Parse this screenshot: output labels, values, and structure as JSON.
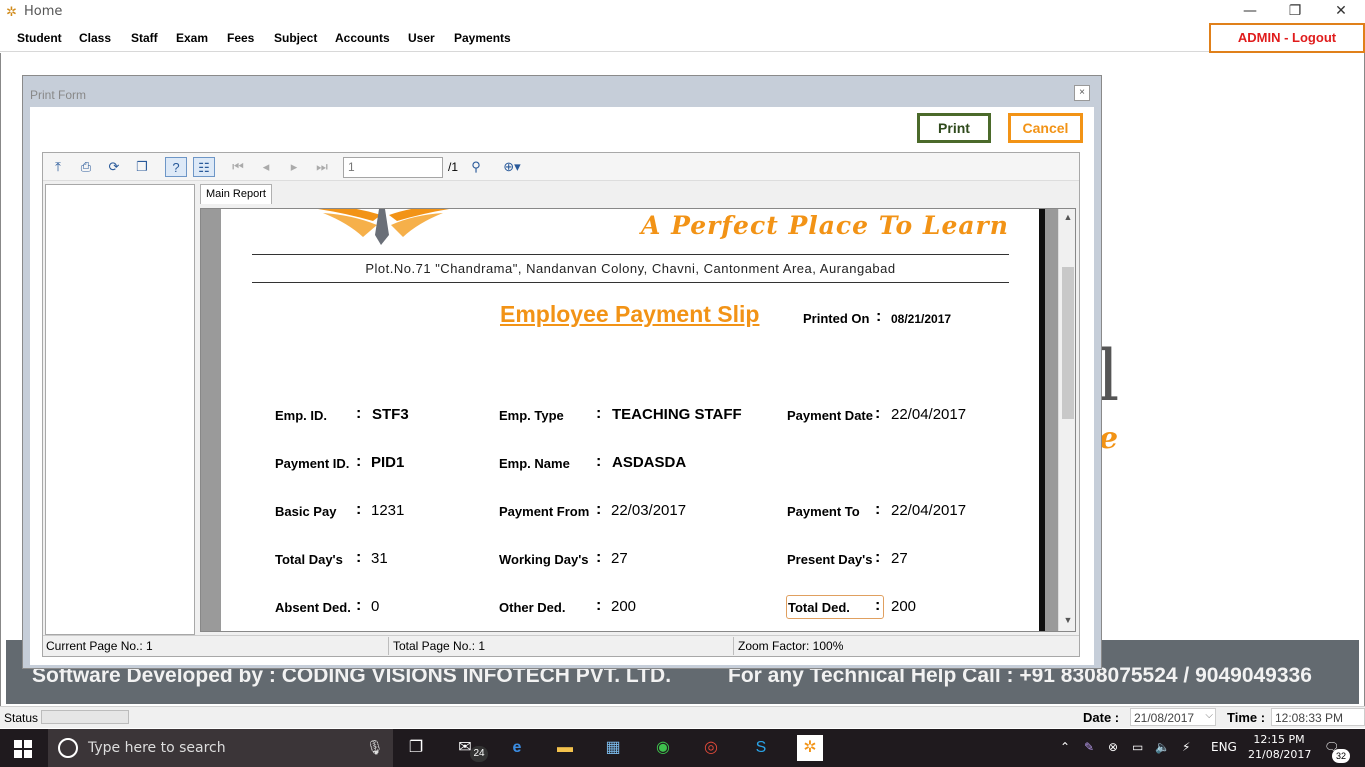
{
  "window": {
    "title": "Home",
    "minimize": "—",
    "restore": "❐",
    "close": "✕"
  },
  "menu": [
    "Student",
    "Class",
    "Staff",
    "Exam",
    "Fees",
    "Subject",
    "Accounts",
    "User",
    "Payments"
  ],
  "logout_label": "ADMIN - Logout",
  "background": {
    "footer_developer": "Software Developed by : CODING VISIONS INFOTECH PVT. LTD.",
    "footer_help": "For any Technical Help Call : +91 8308075524 / 9049049336",
    "letter": "l",
    "letter2": "e"
  },
  "dialog": {
    "title": "Print Form",
    "close": "×",
    "print_label": "Print",
    "cancel_label": "Cancel"
  },
  "viewer": {
    "page_input": "1",
    "page_total": "/1",
    "tab_label": "Main Report",
    "current_page": "Current Page No.: 1",
    "total_page": "Total Page No.: 1",
    "zoom": "Zoom Factor: 100%"
  },
  "report": {
    "tagline": "A Perfect Place To Learn",
    "address": "Plot.No.71 \"Chandrama\", Nandanvan Colony, Chavni, Cantonment Area, Aurangabad",
    "title": "Employee Payment Slip",
    "printed_on_label": "Printed On",
    "printed_on": "08/21/2017",
    "colon": ":",
    "fields": {
      "emp_id_label": "Emp. ID.",
      "emp_id": "STF3",
      "emp_type_label": "Emp. Type",
      "emp_type": "TEACHING STAFF",
      "payment_date_label": "Payment Date",
      "payment_date": "22/04/2017",
      "payment_id_label": "Payment ID.",
      "payment_id": "PID1",
      "emp_name_label": "Emp. Name",
      "emp_name": "ASDASDA",
      "basic_pay_label": "Basic Pay",
      "basic_pay": "1231",
      "payment_from_label": "Payment From",
      "payment_from": "22/03/2017",
      "payment_to_label": "Payment To",
      "payment_to": "22/04/2017",
      "total_days_label": "Total Day's",
      "total_days": "31",
      "working_days_label": "Working Day's",
      "working_days": "27",
      "present_days_label": "Present Day's",
      "present_days": "27",
      "absent_ded_label": "Absent Ded.",
      "absent_ded": "0",
      "other_ded_label": "Other Ded.",
      "other_ded": "200",
      "total_ded_label": "Total Ded.",
      "total_ded": "200"
    }
  },
  "statusbar": {
    "status_label": "Status",
    "date_label": "Date :",
    "date_value": "21/08/2017",
    "time_label": "Time :",
    "time_value": "12:08:33 PM"
  },
  "taskbar": {
    "search_placeholder": "Type here to search",
    "mail_badge": "24",
    "language": "ENG",
    "time": "12:15 PM",
    "date": "21/08/2017",
    "notification_count": "32"
  },
  "colors": {
    "accent_orange": "#f29316",
    "logout_border": "#e0801a",
    "logout_text": "#e01c1c",
    "print_border": "#4b6a2a"
  }
}
